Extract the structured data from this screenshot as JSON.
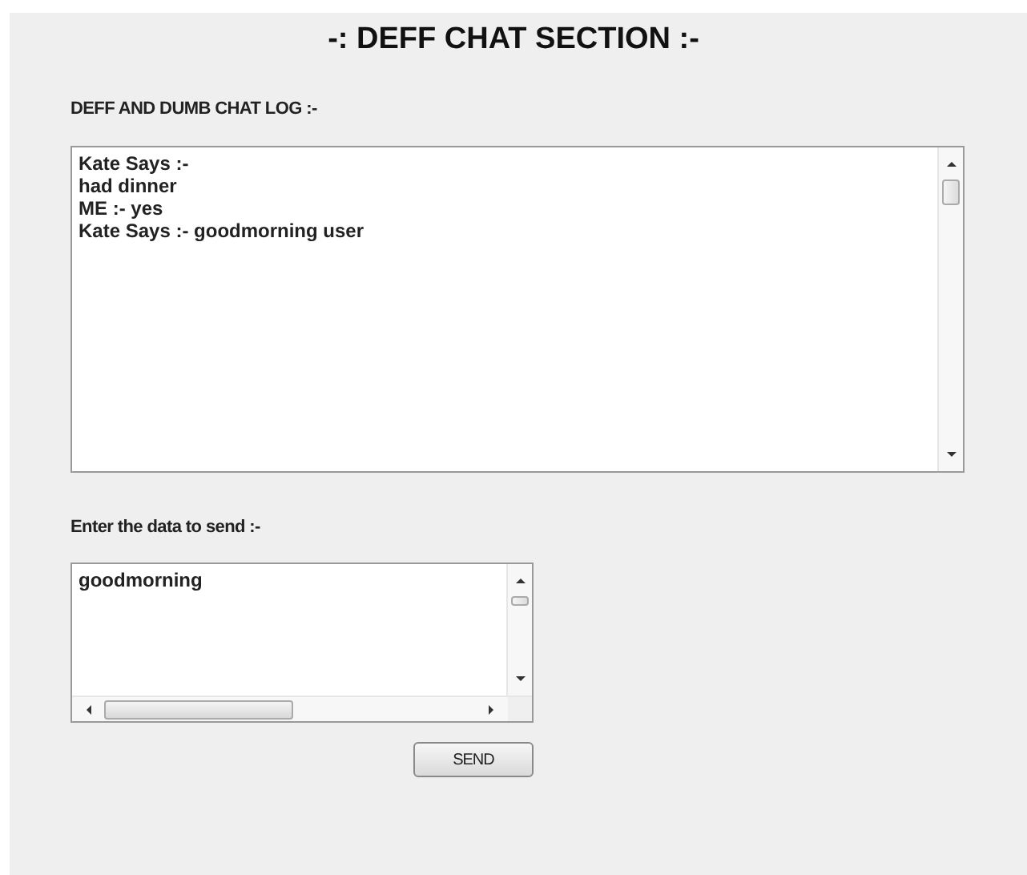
{
  "title": "-: DEFF CHAT SECTION :-",
  "chat_log": {
    "label": "DEFF AND DUMB CHAT LOG :-",
    "lines": [
      "Kate Says :-",
      "had dinner",
      "ME :- yes",
      "Kate Says :- goodmorning user"
    ]
  },
  "message": {
    "label": "Enter the data to send :-",
    "value": "goodmorning"
  },
  "send_button": {
    "label": "SEND"
  }
}
